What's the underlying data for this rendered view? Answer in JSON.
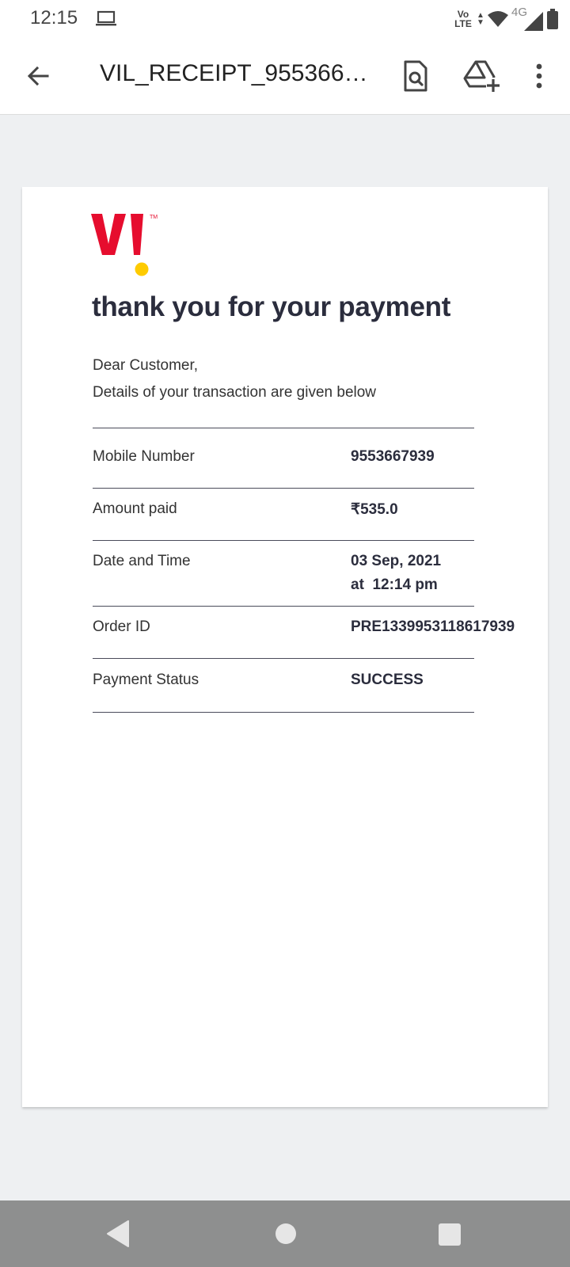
{
  "status_bar": {
    "time": "12:15",
    "volte_top": "Vo",
    "volte_bottom": "LTE",
    "network": "4G",
    "icons": [
      "laptop-icon",
      "volte-icon",
      "data-arrows-icon",
      "wifi-icon",
      "cellular-signal-icon",
      "battery-icon"
    ]
  },
  "app_bar": {
    "title": "VIL_RECEIPT_9553667...",
    "icons": [
      "back-arrow-icon",
      "find-in-page-icon",
      "add-to-drive-icon",
      "more-vert-icon"
    ]
  },
  "receipt": {
    "brand_colors": {
      "red": "#e60d2e",
      "yellow": "#fecb00"
    },
    "logo_text": "VI",
    "heading": "thank you for your payment",
    "greeting": "Dear Customer,",
    "intro": "Details of your transaction are given below",
    "rows": [
      {
        "label": "Mobile Number",
        "value": "9553667939"
      },
      {
        "label": "Amount paid",
        "value": "₹535.0"
      },
      {
        "label": "Date and Time",
        "value": "03 Sep, 2021",
        "value2": "at  12:14 pm"
      },
      {
        "label": "Order ID",
        "value": "PRE1339953118617939"
      },
      {
        "label": "Payment Status",
        "value": "SUCCESS"
      }
    ]
  },
  "nav_bar": {
    "icons": [
      "nav-back-icon",
      "nav-home-icon",
      "nav-recents-icon"
    ]
  }
}
